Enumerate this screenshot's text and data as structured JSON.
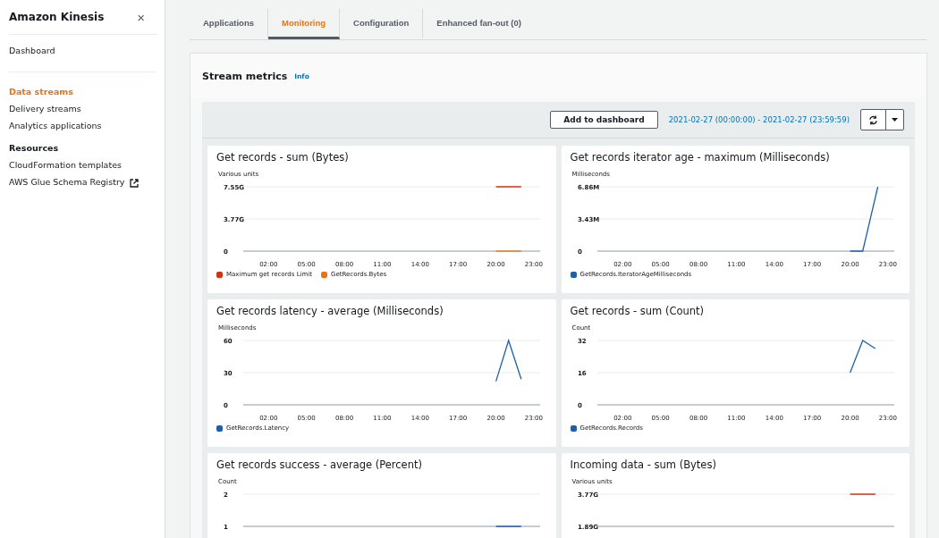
{
  "sidebar": {
    "title": "Amazon Kinesis",
    "close": "×",
    "top_items": [
      {
        "label": "Dashboard",
        "selected": false
      }
    ],
    "items": [
      {
        "label": "Data streams",
        "selected": true
      },
      {
        "label": "Delivery streams",
        "selected": false
      },
      {
        "label": "Analytics applications",
        "selected": false
      }
    ],
    "section": "Resources",
    "resource_items": [
      {
        "label": "CloudFormation templates",
        "external": false
      },
      {
        "label": "AWS Glue Schema Registry",
        "external": true
      }
    ]
  },
  "tabs": [
    {
      "label": "Applications",
      "selected": false
    },
    {
      "label": "Monitoring",
      "selected": true
    },
    {
      "label": "Configuration",
      "selected": false
    },
    {
      "label": "Enhanced fan-out (0)",
      "selected": false
    }
  ],
  "panel": {
    "title": "Stream metrics",
    "info": "Info",
    "add_button": "Add to dashboard",
    "date_range": "2021-02-27 (00:00:00) - 2021-02-27 (23:59:59)",
    "cards": [
      {
        "title": "Get records - sum (Bytes)",
        "chart_data": {
          "type": "line",
          "ylabel": "Various units",
          "xlim": [
            0,
            23.5
          ],
          "legend": true,
          "ylim": [
            0,
            7.55
          ],
          "x": [
            20,
            22
          ],
          "xticks": [
            {
              "value": 2,
              "label": "02:00"
            },
            {
              "value": 5,
              "label": "05:00"
            },
            {
              "value": 8,
              "label": "08:00"
            },
            {
              "value": 11,
              "label": "11:00"
            },
            {
              "value": 14,
              "label": "14:00"
            },
            {
              "value": 17,
              "label": "17:00"
            },
            {
              "value": 20,
              "label": "20:00"
            },
            {
              "value": 23,
              "label": "23:00"
            }
          ],
          "yticks": [
            {
              "value": 0,
              "label": "0"
            },
            {
              "value": 3.77,
              "label": "3.77G"
            },
            {
              "value": 7.55,
              "label": "7.55G"
            }
          ],
          "series": [
            {
              "name": "Maximum get records Limit",
              "color": "#d13212",
              "values": [
                7.55,
                7.55
              ]
            },
            {
              "name": "GetRecords.Bytes",
              "color": "#ec7211",
              "values": [
                0,
                0
              ]
            }
          ]
        }
      },
      {
        "title": "Get records iterator age - maximum (Milliseconds)",
        "chart_data": {
          "type": "line",
          "ylabel": "Milliseconds",
          "xlim": [
            0,
            23.5
          ],
          "legend": true,
          "ylim": [
            0,
            6.86
          ],
          "x": [
            20,
            21,
            22.2
          ],
          "xticks": [
            {
              "value": 2,
              "label": "02:00"
            },
            {
              "value": 5,
              "label": "05:00"
            },
            {
              "value": 8,
              "label": "08:00"
            },
            {
              "value": 11,
              "label": "11:00"
            },
            {
              "value": 14,
              "label": "14:00"
            },
            {
              "value": 17,
              "label": "17:00"
            },
            {
              "value": 20,
              "label": "20:00"
            },
            {
              "value": 23,
              "label": "23:00"
            }
          ],
          "yticks": [
            {
              "value": 0,
              "label": "0"
            },
            {
              "value": 3.43,
              "label": "3.43M"
            },
            {
              "value": 6.86,
              "label": "6.86M"
            }
          ],
          "series": [
            {
              "name": "GetRecords.IteratorAgeMilliseconds",
              "color": "#1f5fa8",
              "values": [
                0,
                0,
                6.86
              ]
            }
          ]
        }
      },
      {
        "title": "Get records latency - average (Milliseconds)",
        "chart_data": {
          "type": "line",
          "ylabel": "Milliseconds",
          "xlim": [
            0,
            23.5
          ],
          "legend": true,
          "ylim": [
            0,
            60
          ],
          "x": [
            20,
            21,
            22
          ],
          "xticks": [
            {
              "value": 2,
              "label": "02:00"
            },
            {
              "value": 5,
              "label": "05:00"
            },
            {
              "value": 8,
              "label": "08:00"
            },
            {
              "value": 11,
              "label": "11:00"
            },
            {
              "value": 14,
              "label": "14:00"
            },
            {
              "value": 17,
              "label": "17:00"
            },
            {
              "value": 20,
              "label": "20:00"
            },
            {
              "value": 23,
              "label": "23:00"
            }
          ],
          "yticks": [
            0,
            30,
            60
          ],
          "series": [
            {
              "name": "GetRecords.Latency",
              "color": "#1f5fa8",
              "values": [
                22,
                60,
                24
              ]
            }
          ]
        }
      },
      {
        "title": "Get records - sum (Count)",
        "chart_data": {
          "type": "line",
          "ylabel": "Count",
          "xlim": [
            0,
            23.5
          ],
          "legend": true,
          "ylim": [
            0,
            32
          ],
          "x": [
            20,
            21,
            22
          ],
          "xticks": [
            {
              "value": 2,
              "label": "02:00"
            },
            {
              "value": 5,
              "label": "05:00"
            },
            {
              "value": 8,
              "label": "08:00"
            },
            {
              "value": 11,
              "label": "11:00"
            },
            {
              "value": 14,
              "label": "14:00"
            },
            {
              "value": 17,
              "label": "17:00"
            },
            {
              "value": 20,
              "label": "20:00"
            },
            {
              "value": 23,
              "label": "23:00"
            }
          ],
          "yticks": [
            0,
            16,
            32
          ],
          "series": [
            {
              "name": "GetRecords.Records",
              "color": "#1f5fa8",
              "values": [
                16,
                32,
                28
              ]
            }
          ]
        }
      },
      {
        "title": "Get records success - average (Percent)",
        "chart_data": {
          "type": "line",
          "ylabel": "Count",
          "xlim": [
            0,
            23.5
          ],
          "x": [
            20,
            22
          ],
          "ylim": [
            1,
            2
          ],
          "yticks": [
            1,
            2
          ],
          "series": [
            {
              "color": "#1f5fa8",
              "values": [
                1,
                1
              ]
            }
          ]
        }
      },
      {
        "title": "Incoming data - sum (Bytes)",
        "chart_data": {
          "type": "line",
          "ylabel": "Various units",
          "xlim": [
            0,
            23.5
          ],
          "x": [
            20,
            22
          ],
          "ylim": [
            1.89,
            3.77
          ],
          "yticks": [
            {
              "value": 1.89,
              "label": "1.89G"
            },
            {
              "value": 3.77,
              "label": "3.77G"
            }
          ],
          "series": [
            {
              "color": "#d13212",
              "values": [
                3.77,
                3.77
              ]
            }
          ]
        }
      }
    ]
  }
}
